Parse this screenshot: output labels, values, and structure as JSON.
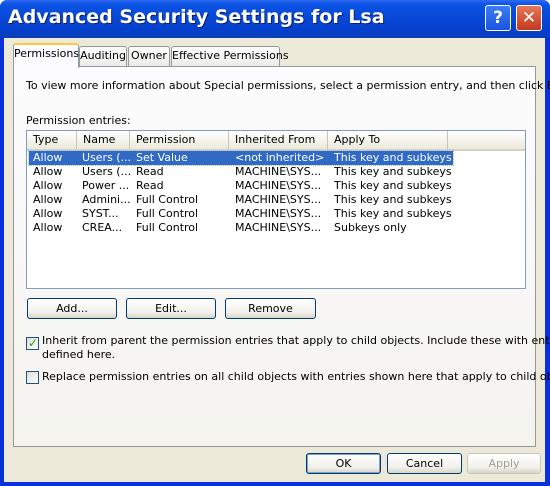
{
  "window": {
    "title": "Advanced Security Settings for Lsa"
  },
  "titlebar_buttons": {
    "help": "?",
    "close": "✕"
  },
  "tabs": [
    {
      "label": "Permissions",
      "active": true
    },
    {
      "label": "Auditing",
      "active": false
    },
    {
      "label": "Owner",
      "active": false
    },
    {
      "label": "Effective Permissions",
      "active": false
    }
  ],
  "permissions": {
    "info_text": "To view more information about Special permissions, select a permission entry, and then click Edit.",
    "entries_label": "Permission entries:",
    "columns": [
      "Type",
      "Name",
      "Permission",
      "Inherited From",
      "Apply To"
    ],
    "rows": [
      {
        "type": "Allow",
        "name": "Users (...",
        "permission": "Set Value",
        "inherited_from": "<not inherited>",
        "apply_to": "This key and subkeys",
        "selected": true
      },
      {
        "type": "Allow",
        "name": "Users (...",
        "permission": "Read",
        "inherited_from": "MACHINE\\SYS...",
        "apply_to": "This key and subkeys",
        "selected": false
      },
      {
        "type": "Allow",
        "name": "Power ...",
        "permission": "Read",
        "inherited_from": "MACHINE\\SYS...",
        "apply_to": "This key and subkeys",
        "selected": false
      },
      {
        "type": "Allow",
        "name": "Admini...",
        "permission": "Full Control",
        "inherited_from": "MACHINE\\SYS...",
        "apply_to": "This key and subkeys",
        "selected": false
      },
      {
        "type": "Allow",
        "name": "SYST...",
        "permission": "Full Control",
        "inherited_from": "MACHINE\\SYS...",
        "apply_to": "This key and subkeys",
        "selected": false
      },
      {
        "type": "Allow",
        "name": "CREA...",
        "permission": "Full Control",
        "inherited_from": "MACHINE\\SYS...",
        "apply_to": "Subkeys only",
        "selected": false
      }
    ],
    "buttons": {
      "add": "Add...",
      "edit": "Edit...",
      "remove": "Remove"
    },
    "inherit_checkbox": {
      "checked": true,
      "line1": "Inherit from parent the permission entries that apply to child objects. Include these with entries explicitly",
      "line2": "defined here."
    },
    "replace_checkbox": {
      "checked": false,
      "label": "Replace permission entries on all child objects with entries shown here that apply to child objects"
    }
  },
  "footer": {
    "ok": "OK",
    "cancel": "Cancel",
    "apply": "Apply"
  }
}
